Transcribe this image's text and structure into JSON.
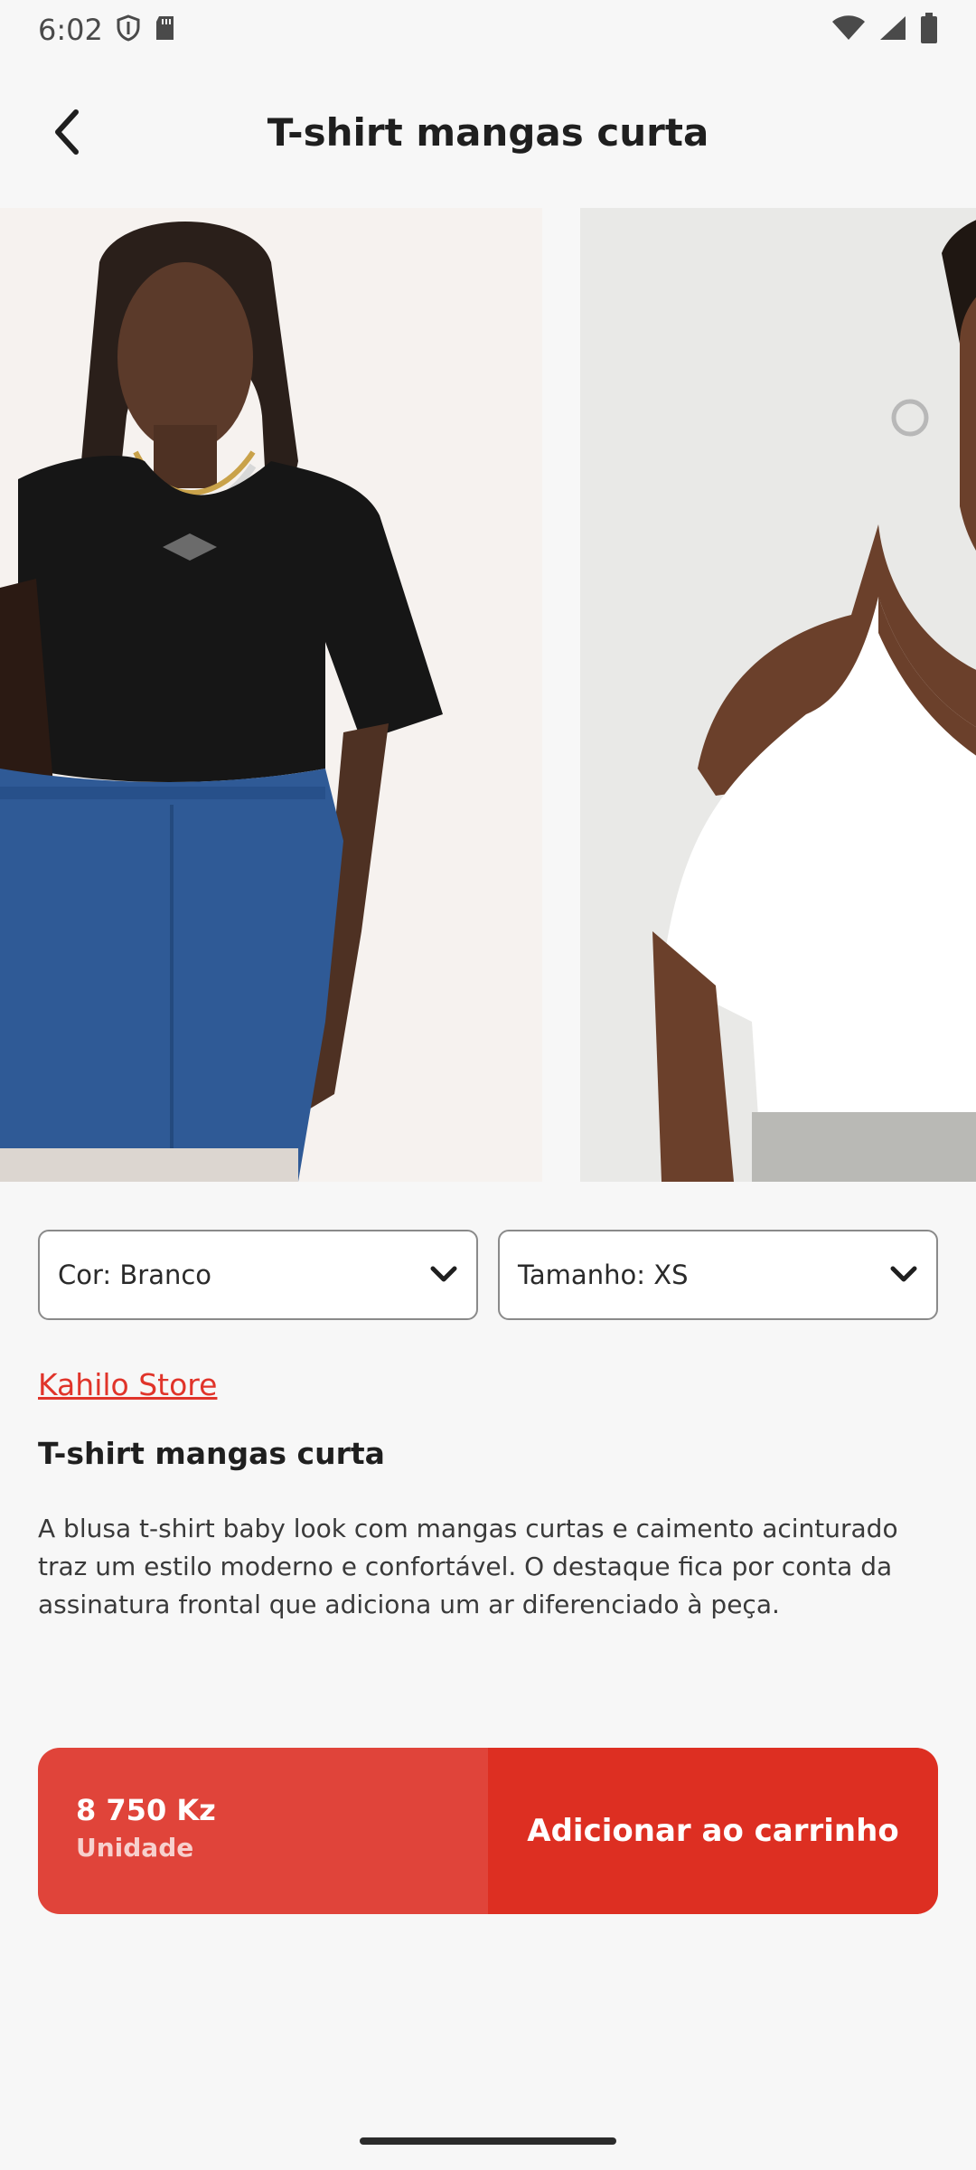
{
  "status_bar": {
    "time": "6:02",
    "icons": [
      "shield-icon",
      "sd-card-icon",
      "wifi-icon",
      "signal-icon",
      "battery-icon"
    ]
  },
  "header": {
    "title": "T-shirt mangas curta",
    "back_icon": "chevron-left-icon"
  },
  "gallery": {
    "images": [
      "model-black-tshirt-photo",
      "model-white-tshirt-photo"
    ],
    "progress": 0.16,
    "accent": "#e0342a"
  },
  "selectors": {
    "color_label": "Cor: Branco",
    "size_label": "Tamanho: XS"
  },
  "product": {
    "store": "Kahilo Store",
    "name": "T-shirt mangas curta",
    "description": "A blusa t-shirt baby look com mangas curtas e caimento acinturado traz um estilo moderno e confortável. O destaque fica por conta da assinatura frontal que adiciona um ar diferenciado à peça."
  },
  "cart": {
    "price": "8 750 Kz",
    "unit": "Unidade",
    "add_label": "Adicionar ao carrinho",
    "price_bg": "#e0443a",
    "button_bg": "#dd2f22"
  }
}
